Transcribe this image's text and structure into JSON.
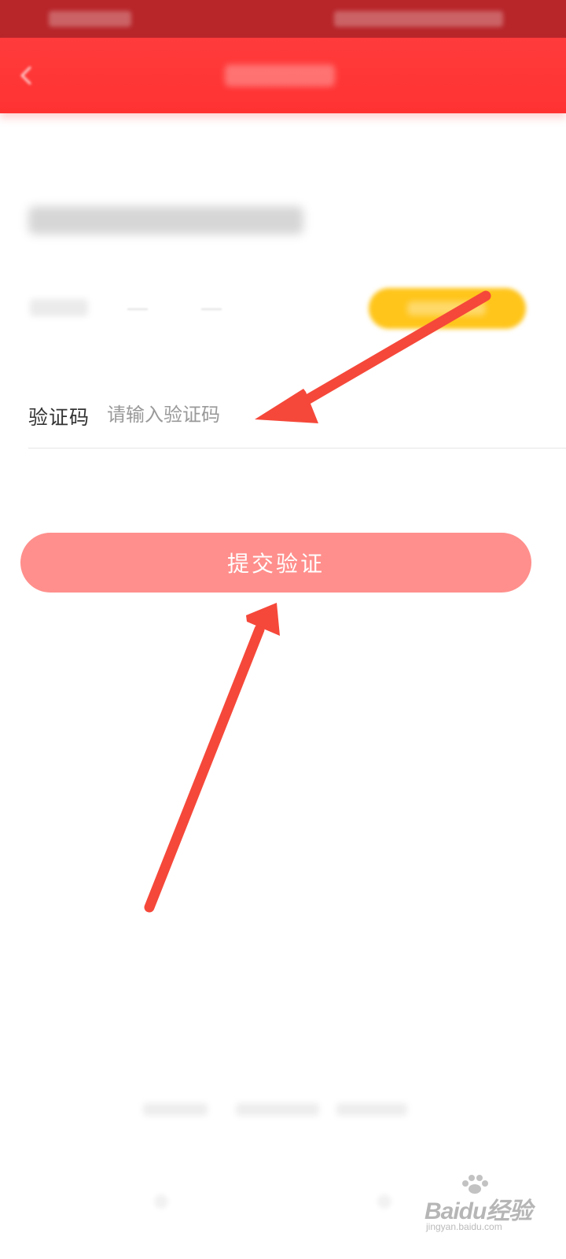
{
  "verification": {
    "code_label": "验证码",
    "code_placeholder": "请输入验证码",
    "submit_label": "提交验证"
  },
  "watermark": {
    "brand": "Baidu经验",
    "url": "jingyan.baidu.com"
  },
  "colors": {
    "status_bar": "#b8262a",
    "nav_bar": "#ff3535",
    "send_code_button": "#ffc51a",
    "submit_button": "#ff8f8c",
    "annotation_arrow": "#f5483a"
  },
  "icons": {
    "back": "back-arrow-icon",
    "watermark": "baidu-paw-icon"
  }
}
